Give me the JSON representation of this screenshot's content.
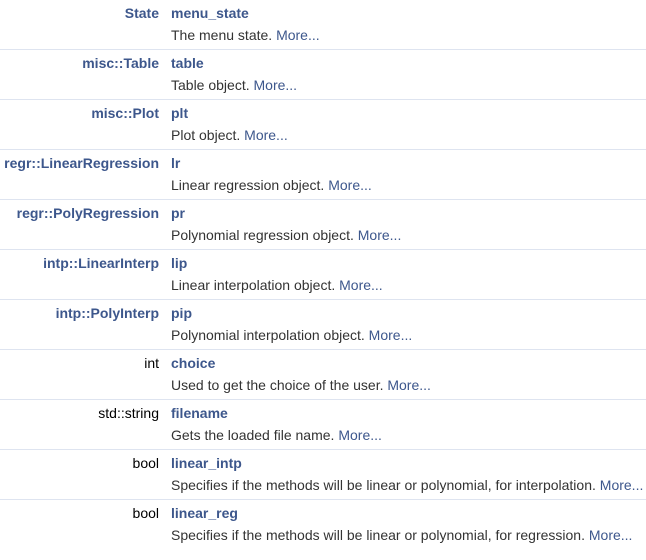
{
  "more_label": "More...",
  "members": [
    {
      "type": "State",
      "type_is_link": true,
      "name": "menu_state",
      "desc": "The menu state."
    },
    {
      "type": "misc::Table",
      "type_is_link": true,
      "name": "table",
      "desc": "Table object."
    },
    {
      "type": "misc::Plot",
      "type_is_link": true,
      "name": "plt",
      "desc": "Plot object."
    },
    {
      "type": "regr::LinearRegression",
      "type_is_link": true,
      "name": "lr",
      "desc": "Linear regression object."
    },
    {
      "type": "regr::PolyRegression",
      "type_is_link": true,
      "name": "pr",
      "desc": "Polynomial regression object."
    },
    {
      "type": "intp::LinearInterp",
      "type_is_link": true,
      "name": "lip",
      "desc": "Linear interpolation object."
    },
    {
      "type": "intp::PolyInterp",
      "type_is_link": true,
      "name": "pip",
      "desc": "Polynomial interpolation object."
    },
    {
      "type": "int",
      "type_is_link": false,
      "name": "choice",
      "desc": "Used to get the choice of the user."
    },
    {
      "type": "std::string",
      "type_is_link": false,
      "name": "filename",
      "desc": "Gets the loaded file name."
    },
    {
      "type": "bool",
      "type_is_link": false,
      "name": "linear_intp",
      "desc": "Specifies if the methods will be linear or polynomial, for interpolation."
    },
    {
      "type": "bool",
      "type_is_link": false,
      "name": "linear_reg",
      "desc": "Specifies if the methods will be linear or polynomial, for regression."
    }
  ]
}
